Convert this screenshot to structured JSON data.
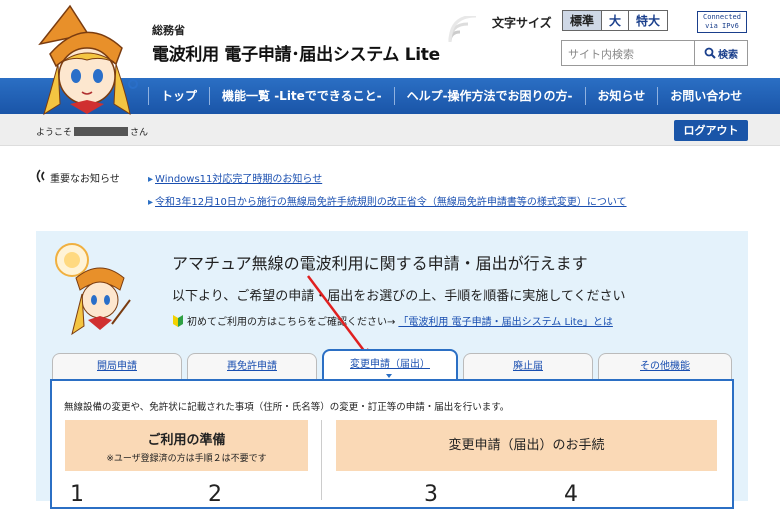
{
  "header": {
    "ministry": "総務省",
    "system_title": "電波利用 電子申請･届出システム Lite",
    "font_size_label": "文字サイズ",
    "font_sizes": [
      "標準",
      "大",
      "特大"
    ],
    "ipv6_badge_line1": "Connected",
    "ipv6_badge_line2": "via IPv6",
    "search_placeholder": "サイト内検索",
    "search_button": "検索"
  },
  "nav": {
    "items": [
      "トップ",
      "機能一覧 -Liteでできること-",
      "ヘルプ-操作方法でお困りの方-",
      "お知らせ",
      "お問い合わせ"
    ]
  },
  "user": {
    "welcome_prefix": "ようこそ",
    "welcome_suffix": "さん",
    "logout": "ログアウト"
  },
  "notices": {
    "label": "重要なお知らせ",
    "items": [
      "Windows11対応完了時期のお知らせ",
      "令和3年12月10日から施行の無線局免許手続規則の改正省令（無線局免許申請書等の様式変更）について"
    ]
  },
  "main": {
    "heading": "アマチュア無線の電波利用に関する申請・届出が行えます",
    "sub": "以下より、ご希望の申請・届出をお選びの上、手順を順番に実施してください",
    "first_time_text": "初めてご利用の方はこちらをご確認ください→",
    "first_time_link": "「電波利用 電子申請・届出システム Lite」とは",
    "tabs": [
      "開局申請",
      "再免許申請",
      "変更申請（届出）",
      "廃止届",
      "その他機能"
    ],
    "active_tab": 2,
    "panel_desc": "無線設備の変更や、免許状に記載された事項（住所・氏名等）の変更・訂正等の申請・届出を行います。",
    "prep_title": "ご利用の準備",
    "prep_sub": "※ユーザ登録済の方は手順２は不要です",
    "proc_title": "変更申請（届出）のお手続",
    "steps": [
      "1",
      "2",
      "3",
      "4"
    ]
  },
  "colors": {
    "nav_blue": "#1a55a8",
    "link_blue": "#1a4fb0",
    "panel_bg": "#e4f2fb",
    "orange_box": "#fad9b6",
    "arrow_red": "#e02020"
  }
}
